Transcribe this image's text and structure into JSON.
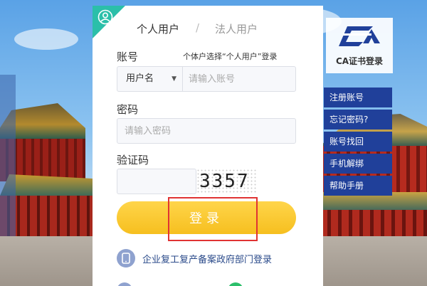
{
  "tabs": {
    "personal": "个人用户",
    "separator": "/",
    "legal": "法人用户"
  },
  "account": {
    "label": "账号",
    "hint": "个体户选择“个人用户”登录",
    "type_selected": "用户名",
    "placeholder": "请输入账号"
  },
  "password": {
    "label": "密码",
    "placeholder": "请输入密码"
  },
  "captcha": {
    "label": "验证码",
    "code": "3357"
  },
  "login": {
    "label": "登录"
  },
  "enterprise": {
    "label": "企业复工复产备案政府部门登录"
  },
  "ca": {
    "logo_text": "CA",
    "title": "CA证书登录"
  },
  "side_menu": [
    {
      "label": "注册账号"
    },
    {
      "label": "忘记密码?"
    },
    {
      "label": "账号找回"
    },
    {
      "label": "手机解绑"
    },
    {
      "label": "帮助手册"
    }
  ],
  "colors": {
    "accent": "#2bbfa9",
    "button": "#f6bf1f",
    "menu": "#20409a",
    "highlight": "#e03333"
  }
}
